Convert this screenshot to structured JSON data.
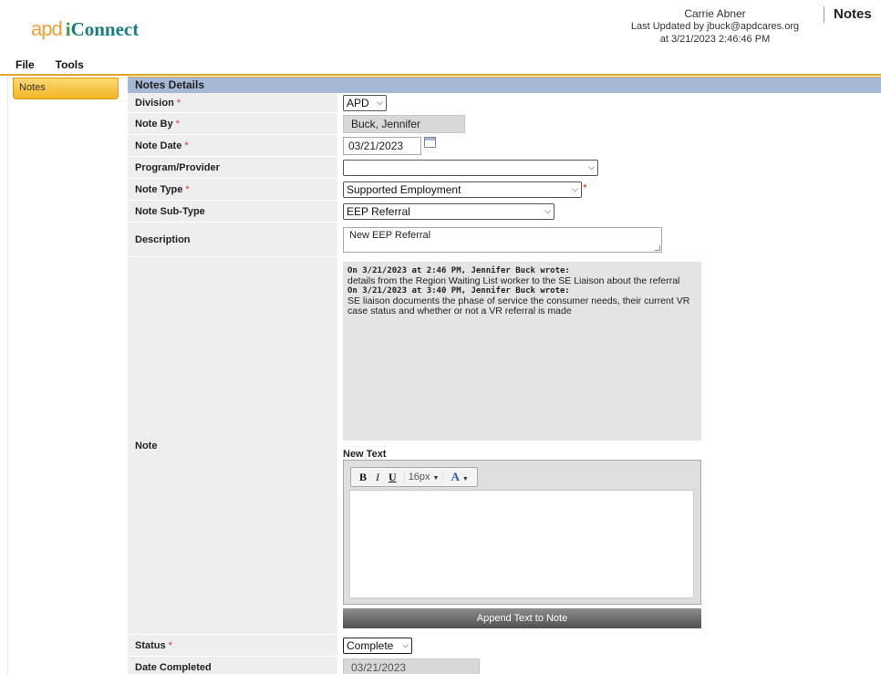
{
  "header": {
    "logo_apd": "apd",
    "logo_i": "i",
    "logo_connect": "Connect",
    "user_name": "Carrie Abner",
    "last_updated_line": "Last Updated by jbuck@apdcares.org",
    "last_updated_at": "at 3/21/2023 2:46:46 PM",
    "page_title": "Notes"
  },
  "menu": {
    "file": "File",
    "tools": "Tools"
  },
  "sidebar": {
    "notes_tab": "Notes"
  },
  "section": {
    "title": "Notes Details"
  },
  "fields": {
    "division": {
      "label": "Division",
      "value": "APD"
    },
    "note_by": {
      "label": "Note By",
      "value": "Buck, Jennifer"
    },
    "note_date": {
      "label": "Note Date",
      "value": "03/21/2023"
    },
    "program_provider": {
      "label": "Program/Provider",
      "value": ""
    },
    "note_type": {
      "label": "Note Type",
      "value": "Supported Employment"
    },
    "note_sub_type": {
      "label": "Note Sub-Type",
      "value": "EEP Referral"
    },
    "description": {
      "label": "Description",
      "value": "New EEP Referral"
    },
    "note": {
      "label": "Note",
      "history": [
        {
          "header": "On 3/21/2023 at 2:46 PM, Jennifer Buck wrote:",
          "text": "details from the Region Waiting List worker to the SE Liaison about the referral"
        },
        {
          "header": "On 3/21/2023 at 3:40 PM, Jennifer Buck wrote:",
          "text": "SE liaison documents the phase of service the consumer needs, their current VR case status and whether or not a VR referral is made"
        }
      ],
      "new_text_label": "New Text",
      "toolbar": {
        "bold": "B",
        "italic": "I",
        "underline": "U",
        "font_size": "16px",
        "color": "A"
      },
      "append_button": "Append Text to Note"
    },
    "status": {
      "label": "Status",
      "value": "Complete"
    },
    "date_completed": {
      "label": "Date Completed",
      "value": "03/21/2023"
    }
  },
  "required_marker": "*",
  "colors": {
    "accent": "#e0a52c",
    "section_header": "#a6b8d6",
    "label_bg": "#eeeeee"
  },
  "icons": [
    "calendar-icon",
    "chevron-down-icon"
  ]
}
